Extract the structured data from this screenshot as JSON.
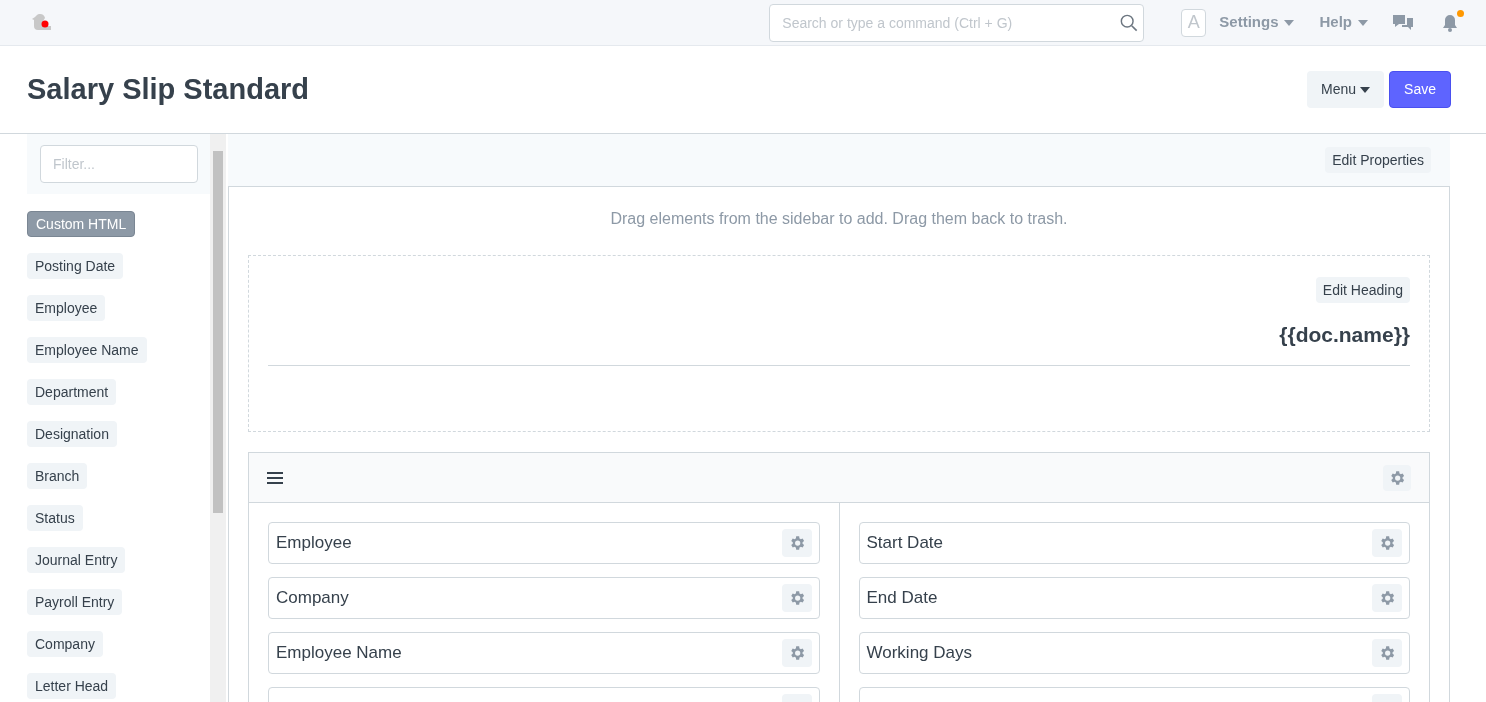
{
  "navbar": {
    "search": {
      "placeholder": "Search or type a command (Ctrl + G)"
    },
    "avatar": "A",
    "menus": [
      "Settings",
      "Help"
    ],
    "notification_dot": true
  },
  "page": {
    "title": "Salary Slip Standard",
    "menu_button": "Menu",
    "save_button": "Save"
  },
  "sidebar": {
    "filter": {
      "placeholder": "Filter..."
    },
    "items": [
      {
        "label": "Custom HTML",
        "selected": true
      },
      {
        "label": "Posting Date",
        "selected": false
      },
      {
        "label": "Employee",
        "selected": false
      },
      {
        "label": "Employee Name",
        "selected": false
      },
      {
        "label": "Department",
        "selected": false
      },
      {
        "label": "Designation",
        "selected": false
      },
      {
        "label": "Branch",
        "selected": false
      },
      {
        "label": "Status",
        "selected": false
      },
      {
        "label": "Journal Entry",
        "selected": false
      },
      {
        "label": "Payroll Entry",
        "selected": false
      },
      {
        "label": "Company",
        "selected": false
      },
      {
        "label": "Letter Head",
        "selected": false
      }
    ]
  },
  "editor": {
    "edit_properties": "Edit Properties",
    "hint": "Drag elements from the sidebar to add. Drag them back to trash.",
    "heading": {
      "edit_button": "Edit Heading",
      "text": "{{doc.name}}"
    },
    "section": {
      "columns": [
        {
          "fields": [
            "Employee",
            "Company",
            "Employee Name"
          ],
          "more_below": true
        },
        {
          "fields": [
            "Start Date",
            "End Date",
            "Working Days"
          ],
          "more_below": true
        }
      ]
    }
  }
}
